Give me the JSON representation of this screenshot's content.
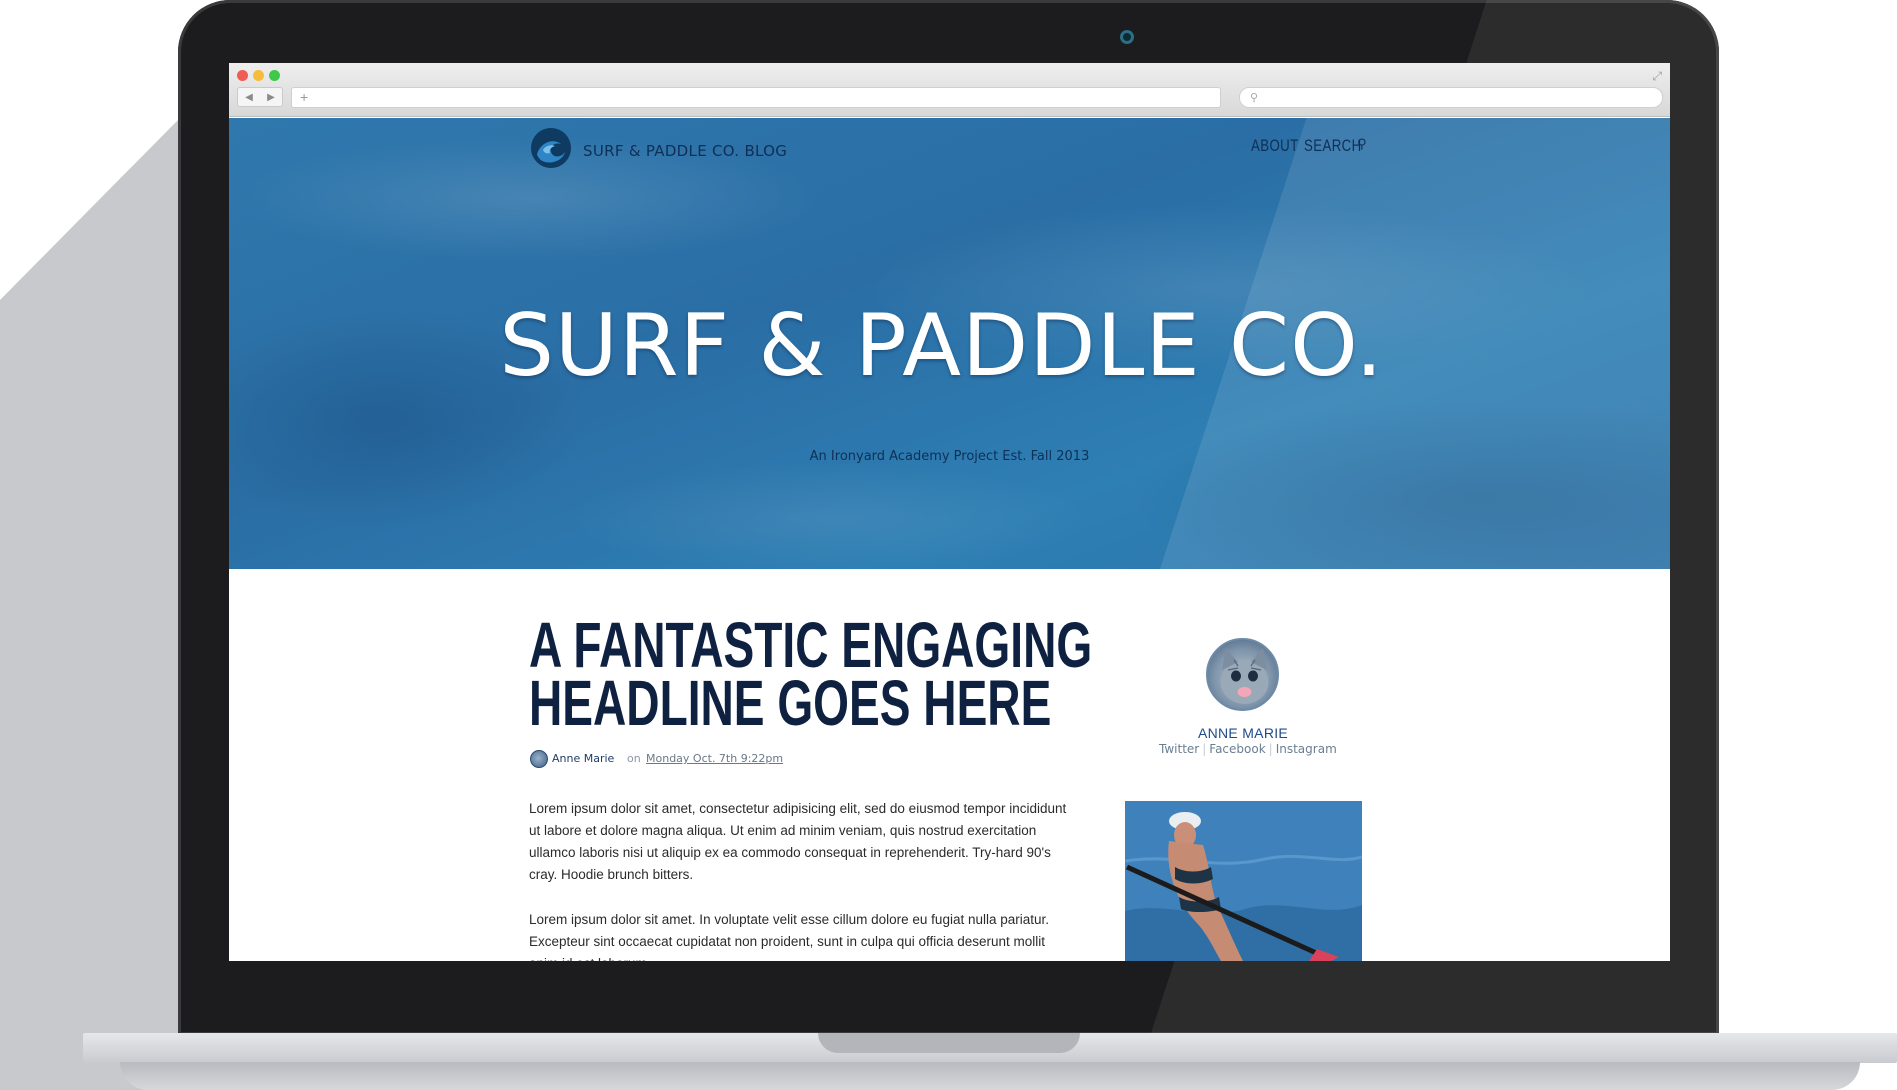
{
  "browser": {
    "nav_back": "◀",
    "nav_forward": "▶",
    "url_placeholder": "+",
    "search_placeholder": "⚲",
    "expand_glyph": "⤢"
  },
  "header": {
    "brand": "SURF & PADDLE CO. BLOG",
    "nav": {
      "about": "ABOUT",
      "search": "SEARCH",
      "search_icon": "⚲"
    }
  },
  "hero": {
    "title": "SURF & PADDLE CO.",
    "subtitle": "An Ironyard Academy Project Est. Fall 2013"
  },
  "post": {
    "headline_line1": "A FANTASTIC ENGAGING",
    "headline_line2": "HEADLINE GOES HERE",
    "author": "Anne Marie",
    "date_prefix": "on",
    "date": "Monday Oct. 7th 9:22pm",
    "paragraph1": "Lorem ipsum dolor sit amet, consectetur adipisicing elit, sed do eiusmod tempor incididunt ut labore et dolore magna aliqua. Ut enim ad minim veniam, quis nostrud exercitation ullamco laboris nisi ut aliquip ex ea commodo consequat in reprehenderit. Try-hard 90's cray. Hoodie brunch bitters.",
    "paragraph2": "Lorem ipsum dolor sit amet. In voluptate velit esse cillum dolore eu fugiat nulla pariatur. Excepteur sint occaecat cupidatat non proident, sunt in culpa qui officia deserunt mollit anim id est laborum."
  },
  "sidebar": {
    "author_name": "ANNE MARIE",
    "links": [
      "Twitter",
      "Facebook",
      "Instagram"
    ]
  },
  "colors": {
    "hero_blue": "#2a73a8",
    "navy": "#0f2140",
    "link_blue": "#1e4b8c"
  }
}
